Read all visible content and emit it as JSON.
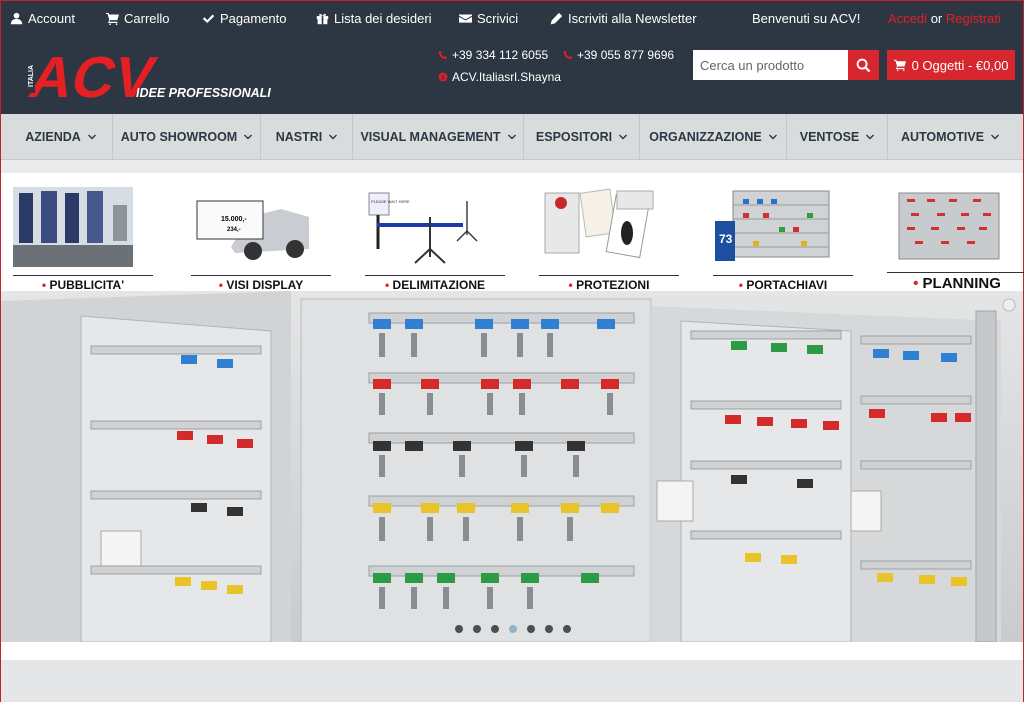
{
  "topbar": {
    "account": "Account",
    "cart": "Carrello",
    "checkout": "Pagamento",
    "wishlist": "Lista dei desideri",
    "contact": "Scrivici",
    "newsletter": "Iscriviti alla Newsletter",
    "welcome": "Benvenuti su ACV!",
    "login": "Accedi",
    "or": "or",
    "register": "Registrati"
  },
  "header": {
    "logo_text": "ACV",
    "logo_badge": "ITALIA",
    "tagline": "IDEE PROFESSIONALI",
    "phone1": "+39 334 112 6055",
    "phone2": "+39 055 877 9696",
    "skype": "ACV.Italiasrl.Shayna",
    "search_placeholder": "Cerca un prodotto",
    "cart_label": "0 Oggetti - €0,00"
  },
  "nav": [
    {
      "label": "AZIENDA"
    },
    {
      "label": "AUTO SHOWROOM"
    },
    {
      "label": "NASTRI"
    },
    {
      "label": "VISUAL MANAGEMENT"
    },
    {
      "label": "ESPOSITORI"
    },
    {
      "label": "ORGANIZZAZIONE"
    },
    {
      "label": "VENTOSE"
    },
    {
      "label": "AUTOMOTIVE"
    }
  ],
  "categories": [
    {
      "label": "PUBBLICITA'"
    },
    {
      "label": "VISI DISPLAY"
    },
    {
      "label": "DELIMITAZIONE"
    },
    {
      "label": "PROTEZIONI"
    },
    {
      "label": "PORTACHIAVI"
    },
    {
      "label": "PLANNING"
    }
  ],
  "thumb_texts": {
    "price1": "15.000,-",
    "price2": "234,-",
    "sign": "PLEASE WAIT HERE",
    "number": "73"
  },
  "colors": {
    "dark": "#2c3743",
    "accent": "#d7262d",
    "nav_bg": "#d9dcdd"
  }
}
